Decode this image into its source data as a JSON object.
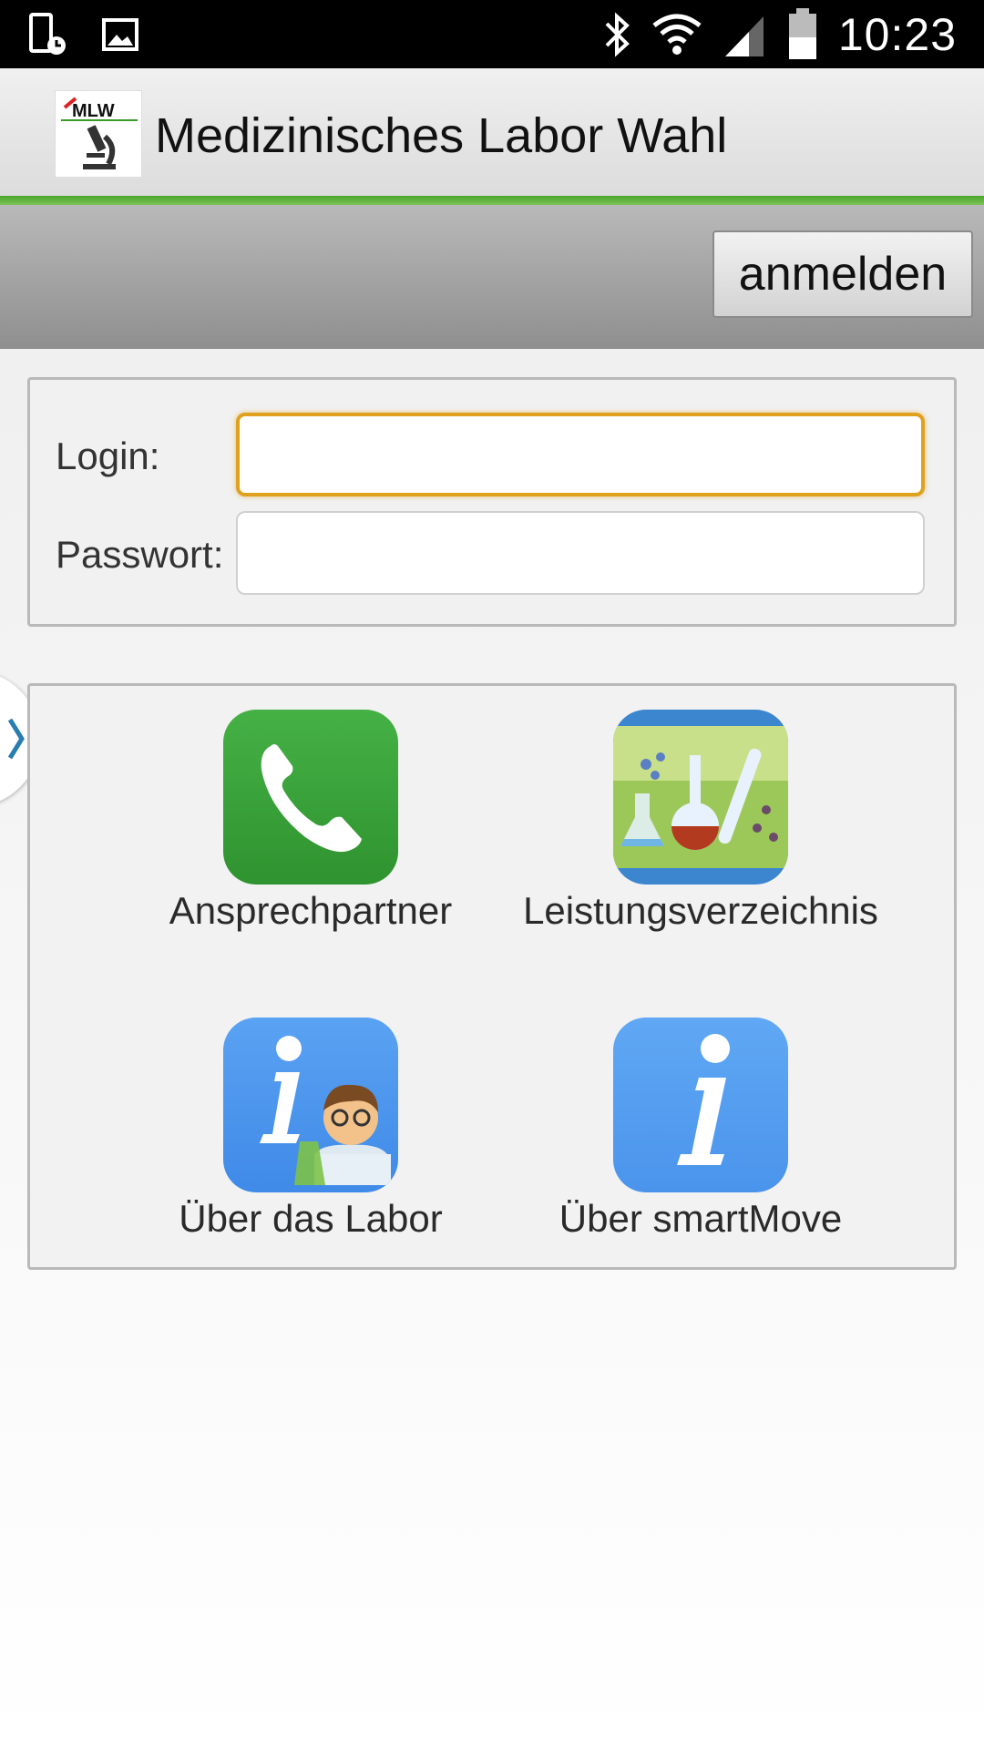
{
  "status_bar": {
    "time": "10:23",
    "icons": [
      "alarm-phone-icon",
      "image-icon",
      "bluetooth-icon",
      "wifi-icon",
      "signal-icon",
      "battery-icon"
    ]
  },
  "action_bar": {
    "title": "Medizinisches Labor Wahl",
    "logo_text": "MLW"
  },
  "toolbar": {
    "login_button_label": "anmelden"
  },
  "login_form": {
    "login_label": "Login:",
    "login_value": "",
    "password_label": "Passwort:",
    "password_value": ""
  },
  "tiles": [
    {
      "label": "Ansprechpartner",
      "icon": "phone-icon",
      "color": "#3aa33a"
    },
    {
      "label": "Leistungsverzeichnis",
      "icon": "lab-flasks-icon",
      "color": "#3c86d0"
    },
    {
      "label": "Über das Labor",
      "icon": "info-scientist-icon",
      "color": "#4f98ee"
    },
    {
      "label": "Über smartMove",
      "icon": "info-icon",
      "color": "#549df0"
    }
  ],
  "colors": {
    "accent_green": "#4aa52a",
    "focus_orange": "#e0a21e"
  }
}
